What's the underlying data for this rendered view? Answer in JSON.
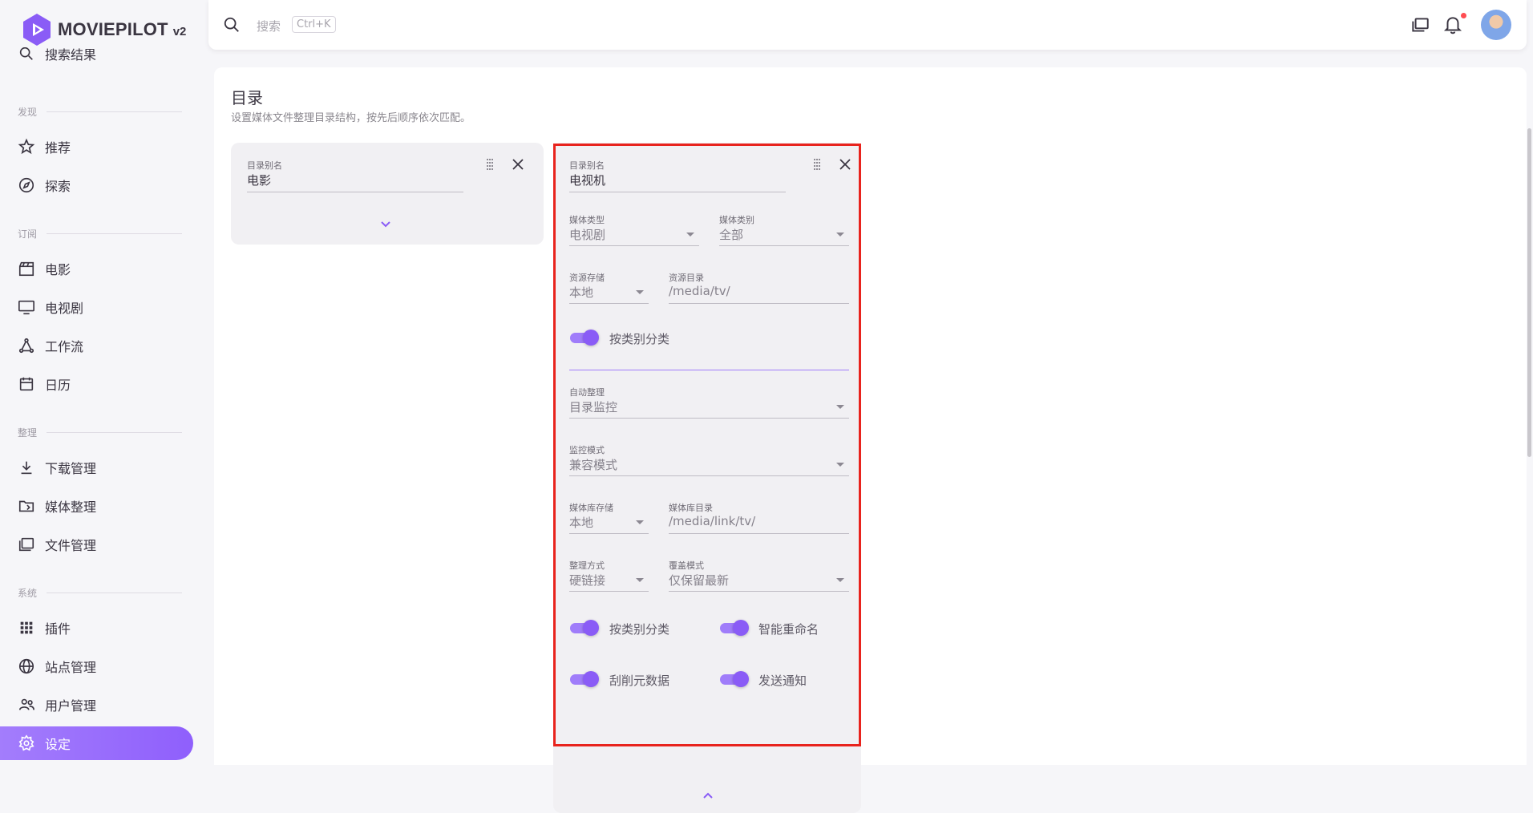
{
  "app": {
    "name": "MOVIEPILOT",
    "version": "v2"
  },
  "sidebar": {
    "partial_item": "搜索结果",
    "sections": {
      "discover": "发现",
      "subscribe": "订阅",
      "organize": "整理",
      "system": "系统"
    },
    "items": [
      {
        "label": "推荐",
        "icon": "star-icon"
      },
      {
        "label": "探索",
        "icon": "compass-icon"
      },
      {
        "label": "电影",
        "icon": "clapperboard-icon"
      },
      {
        "label": "电视剧",
        "icon": "tv-icon"
      },
      {
        "label": "工作流",
        "icon": "workflow-icon"
      },
      {
        "label": "日历",
        "icon": "calendar-icon"
      },
      {
        "label": "下载管理",
        "icon": "download-icon"
      },
      {
        "label": "媒体整理",
        "icon": "folder-move-icon"
      },
      {
        "label": "文件管理",
        "icon": "files-icon"
      },
      {
        "label": "插件",
        "icon": "apps-grid-icon"
      },
      {
        "label": "站点管理",
        "icon": "globe-icon"
      },
      {
        "label": "用户管理",
        "icon": "users-icon"
      },
      {
        "label": "设定",
        "icon": "gear-icon",
        "active": true
      }
    ]
  },
  "header": {
    "search_placeholder": "搜索",
    "search_shortcut": "Ctrl+K"
  },
  "page": {
    "title": "目录",
    "subtitle": "设置媒体文件整理目录结构，按先后顺序依次匹配。"
  },
  "cards": [
    {
      "alias_label": "目录别名",
      "alias_value": "电影",
      "expanded": false
    },
    {
      "alias_label": "目录别名",
      "alias_value": "电视机",
      "expanded": true,
      "media_type": {
        "label": "媒体类型",
        "value": "电视剧"
      },
      "media_category": {
        "label": "媒体类别",
        "value": "全部"
      },
      "source_storage": {
        "label": "资源存储",
        "value": "本地"
      },
      "source_dir": {
        "label": "资源目录",
        "value": "/media/tv/"
      },
      "classify_toggle": {
        "label": "按类别分类",
        "on": true
      },
      "auto_organize": {
        "label": "自动整理",
        "value": "目录监控"
      },
      "monitor_mode": {
        "label": "监控模式",
        "value": "兼容模式"
      },
      "library_storage": {
        "label": "媒体库存储",
        "value": "本地"
      },
      "library_dir": {
        "label": "媒体库目录",
        "value": "/media/link/tv/"
      },
      "transfer_type": {
        "label": "整理方式",
        "value": "硬链接"
      },
      "overwrite_mode": {
        "label": "覆盖模式",
        "value": "仅保留最新"
      },
      "toggles": [
        {
          "label": "按类别分类",
          "on": true
        },
        {
          "label": "智能重命名",
          "on": true
        },
        {
          "label": "刮削元数据",
          "on": true
        },
        {
          "label": "发送通知",
          "on": true
        }
      ]
    }
  ],
  "colors": {
    "accent": "#8a5cf6",
    "highlight": "#e8231d"
  }
}
